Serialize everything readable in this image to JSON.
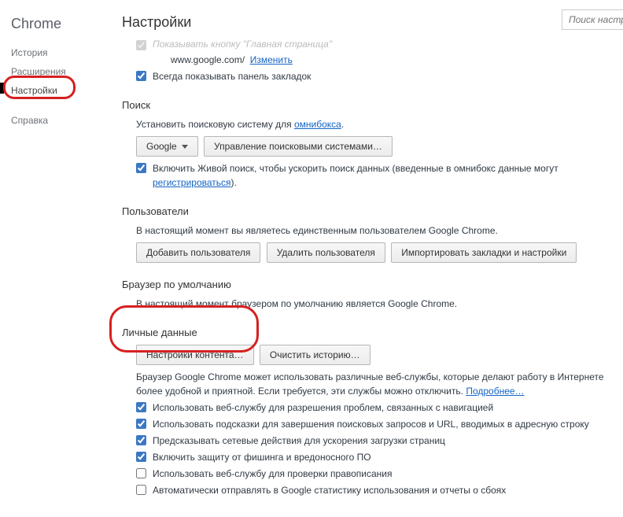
{
  "appTitle": "Chrome",
  "sidebar": {
    "items": [
      {
        "label": "История"
      },
      {
        "label": "Расширения"
      },
      {
        "label": "Настройки"
      },
      {
        "label": "Справка"
      }
    ]
  },
  "pageTitle": "Настройки",
  "search": {
    "placeholder": "Поиск настро"
  },
  "homepage": {
    "showButtonLabel": "Показывать кнопку \"Главная страница\"",
    "url": "www.google.com/",
    "changeLink": "Изменить",
    "alwaysBookmarksBar": "Всегда показывать панель закладок"
  },
  "searchSection": {
    "title": "Поиск",
    "desc": "Установить поисковую систему для ",
    "omniboxLink": "омнибокса",
    "engine": "Google",
    "manageBtn": "Управление поисковыми системами…",
    "instant1": "Включить Живой поиск, чтобы ускорить поиск данных (введенные в омнибокс данные могут ",
    "instantLink": "регистрироваться",
    "instant2": ")."
  },
  "users": {
    "title": "Пользователи",
    "desc": "В настоящий момент вы являетесь единственным пользователем Google Chrome.",
    "addBtn": "Добавить пользователя",
    "removeBtn": "Удалить пользователя",
    "importBtn": "Импортировать закладки и настройки"
  },
  "defaultBrowser": {
    "title": "Браузер по умолчанию",
    "desc": "В настоящий момент браузером по умолчанию является Google Chrome."
  },
  "privacy": {
    "title": "Личные данные",
    "contentBtn": "Настройки контента…",
    "clearBtn": "Очистить историю…",
    "desc1": "Браузер Google Chrome может использовать различные веб-службы, которые делают работу в Интернете более удобной и приятной. Если требуется, эти службы можно отключить. ",
    "learnMore": "Подробнее…",
    "checks": [
      {
        "label": "Использовать веб-службу для разрешения проблем, связанных с навигацией",
        "checked": true
      },
      {
        "label": "Использовать подсказки для завершения поисковых запросов и URL, вводимых в адресную строку",
        "checked": true
      },
      {
        "label": "Предсказывать сетевые действия для ускорения загрузки страниц",
        "checked": true
      },
      {
        "label": "Включить защиту от фишинга и вредоносного ПО",
        "checked": true
      },
      {
        "label": "Использовать веб-службу для проверки правописания",
        "checked": false
      },
      {
        "label": "Автоматически отправлять в Google статистику использования и отчеты о сбоях",
        "checked": false
      }
    ]
  }
}
